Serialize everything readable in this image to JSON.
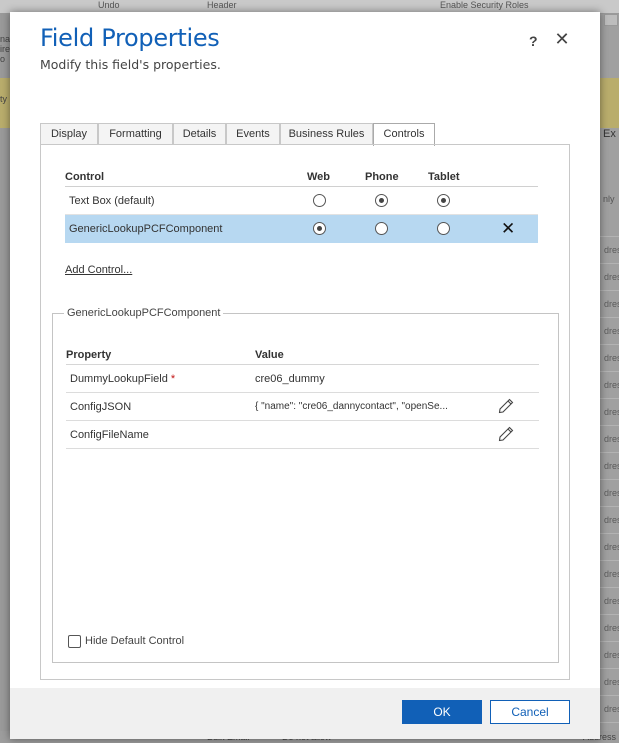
{
  "background": {
    "toolbar_items": [
      "Undo",
      "Header",
      "Enable Security Roles"
    ],
    "left_fragments": [
      "na",
      "ire",
      "o",
      "ty"
    ],
    "right_header": "Ex",
    "right_fragment": "nly",
    "right_rows": [
      "dres",
      "dres",
      "dres",
      "dres",
      "dres",
      "dres",
      "dres",
      "dres",
      "dres",
      "dres",
      "dres",
      "dres",
      "dres",
      "dres",
      "dres",
      "dres",
      "dres",
      "dres",
      "dres",
      "dres"
    ],
    "bottom_items": [
      "Bulk Email",
      "Do not allow",
      "Address"
    ]
  },
  "dialog": {
    "title": "Field Properties",
    "subtitle": "Modify this field's properties.",
    "help_icon": "?",
    "close_icon": "✕",
    "accent_color": "#1160b7"
  },
  "tabs": [
    {
      "label": "Display",
      "active": false
    },
    {
      "label": "Formatting",
      "active": false
    },
    {
      "label": "Details",
      "active": false
    },
    {
      "label": "Events",
      "active": false
    },
    {
      "label": "Business Rules",
      "active": false
    },
    {
      "label": "Controls",
      "active": true
    }
  ],
  "controls": {
    "headers": {
      "control": "Control",
      "web": "Web",
      "phone": "Phone",
      "tablet": "Tablet"
    },
    "rows": [
      {
        "name": "Text Box (default)",
        "web": false,
        "phone": true,
        "tablet": true,
        "selected": false,
        "removable": false
      },
      {
        "name": "GenericLookupPCFComponent",
        "web": true,
        "phone": false,
        "tablet": false,
        "selected": true,
        "removable": true
      }
    ],
    "add_control_label": "Add Control..."
  },
  "properties": {
    "legend": "GenericLookupPCFComponent",
    "headers": {
      "property": "Property",
      "value": "Value"
    },
    "rows": [
      {
        "property": "DummyLookupField",
        "required": true,
        "required_mark": "*",
        "value": "cre06_dummy",
        "editable": false
      },
      {
        "property": "ConfigJSON",
        "required": false,
        "required_mark": "",
        "value": "{ \"name\": \"cre06_dannycontact\", \"openSe...",
        "editable": true
      },
      {
        "property": "ConfigFileName",
        "required": false,
        "required_mark": "",
        "value": "",
        "editable": true
      }
    ],
    "hide_default_label": "Hide Default Control",
    "hide_default_checked": false
  },
  "footer": {
    "ok_label": "OK",
    "cancel_label": "Cancel"
  }
}
